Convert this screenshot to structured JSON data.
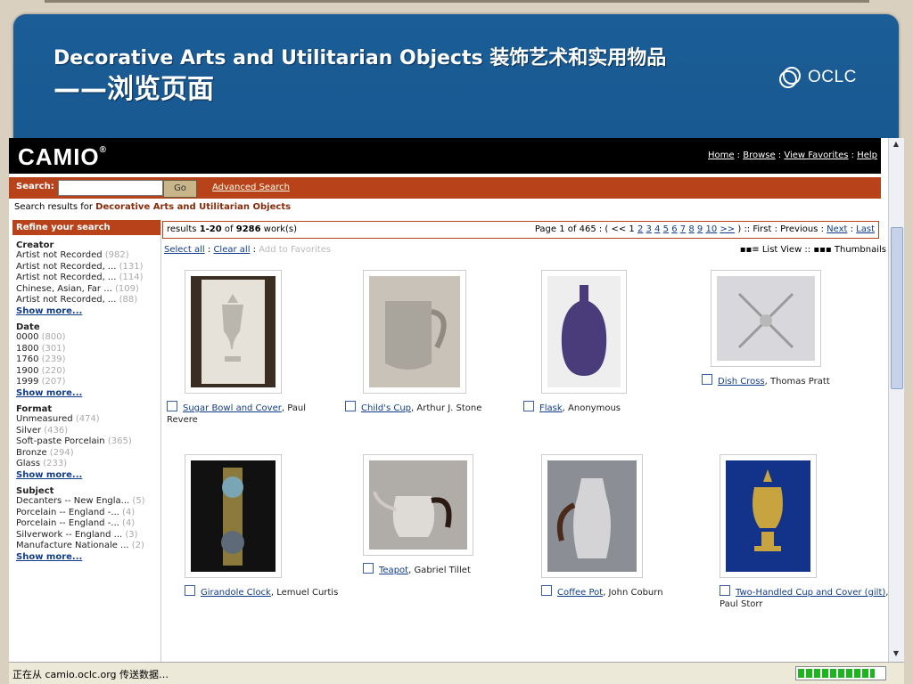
{
  "slide": {
    "title_line1": "Decorative Arts and Utilitarian Objects 装饰艺术和实用物品",
    "title_line2": "——浏览页面",
    "logo_text": "OCLC"
  },
  "camio": {
    "logo": "CAMIO",
    "reg": "®",
    "nav": [
      "Home",
      "Browse",
      "View Favorites",
      "Help"
    ],
    "search_label": "Search:",
    "search_value": "",
    "go_label": "Go",
    "advanced_label": "Advanced Search",
    "results_for_prefix": "Search results for",
    "results_for_term": "Decorative Arts and Utilitarian Objects",
    "refine_title": "Refine your search",
    "facets": [
      {
        "title": "Creator",
        "items": [
          {
            "label": "Artist not Recorded",
            "count": "(982)"
          },
          {
            "label": "Artist not Recorded, ...",
            "count": "(131)"
          },
          {
            "label": "Artist not Recorded, ...",
            "count": "(114)"
          },
          {
            "label": "Chinese, Asian, Far ...",
            "count": "(109)"
          },
          {
            "label": "Artist not Recorded, ...",
            "count": "(88)"
          }
        ]
      },
      {
        "title": "Date",
        "items": [
          {
            "label": "0000",
            "count": "(800)"
          },
          {
            "label": "1800",
            "count": "(301)"
          },
          {
            "label": "1760",
            "count": "(239)"
          },
          {
            "label": "1900",
            "count": "(220)"
          },
          {
            "label": "1999",
            "count": "(207)"
          }
        ]
      },
      {
        "title": "Format",
        "items": [
          {
            "label": "Unmeasured",
            "count": "(474)"
          },
          {
            "label": "Silver",
            "count": "(436)"
          },
          {
            "label": "Soft-paste Porcelain",
            "count": "(365)"
          },
          {
            "label": "Bronze",
            "count": "(294)"
          },
          {
            "label": "Glass",
            "count": "(233)"
          }
        ]
      },
      {
        "title": "Subject",
        "items": [
          {
            "label": "Decanters -- New Engla...",
            "count": "(5)"
          },
          {
            "label": "Porcelain -- England -...",
            "count": "(4)"
          },
          {
            "label": "Porcelain -- England -...",
            "count": "(4)"
          },
          {
            "label": "Silverwork -- England ...",
            "count": "(3)"
          },
          {
            "label": "Manufacture Nationale ...",
            "count": "(2)"
          }
        ]
      }
    ],
    "show_more": "Show more...",
    "results_text_pre": "results",
    "results_range": "1-20",
    "results_of": "of",
    "results_total": "9286",
    "results_suffix": "work(s)",
    "page_text": "Page 1 of 465 : ( <<  1",
    "pages": [
      "2",
      "3",
      "4",
      "5",
      "6",
      "7",
      "8",
      "9",
      "10",
      ">>"
    ],
    "page_tail": ") :: First : Previous :",
    "next_label": "Next",
    "last_label": "Last",
    "select_all": "Select all",
    "clear_all": "Clear all",
    "add_fav": "Add to Favorites",
    "list_view": "List View",
    "thumbnails": "Thumbnails",
    "items": [
      {
        "title": "Sugar Bowl and Cover",
        "creator": "Paul Revere"
      },
      {
        "title": "Child's Cup",
        "creator": "Arthur J. Stone"
      },
      {
        "title": "Flask",
        "creator": "Anonymous"
      },
      {
        "title": "Dish Cross",
        "creator": "Thomas Pratt"
      },
      {
        "title": "Girandole Clock",
        "creator": "Lemuel Curtis"
      },
      {
        "title": "Teapot",
        "creator": "Gabriel Tillet"
      },
      {
        "title": "Coffee Pot",
        "creator": "John Coburn"
      },
      {
        "title": "Two-Handled Cup and Cover (gilt)",
        "creator": "Paul Storr"
      }
    ]
  },
  "statusbar": {
    "text": "正在从 camio.oclc.org 传送数据…",
    "progress_fraction": 0.9
  }
}
